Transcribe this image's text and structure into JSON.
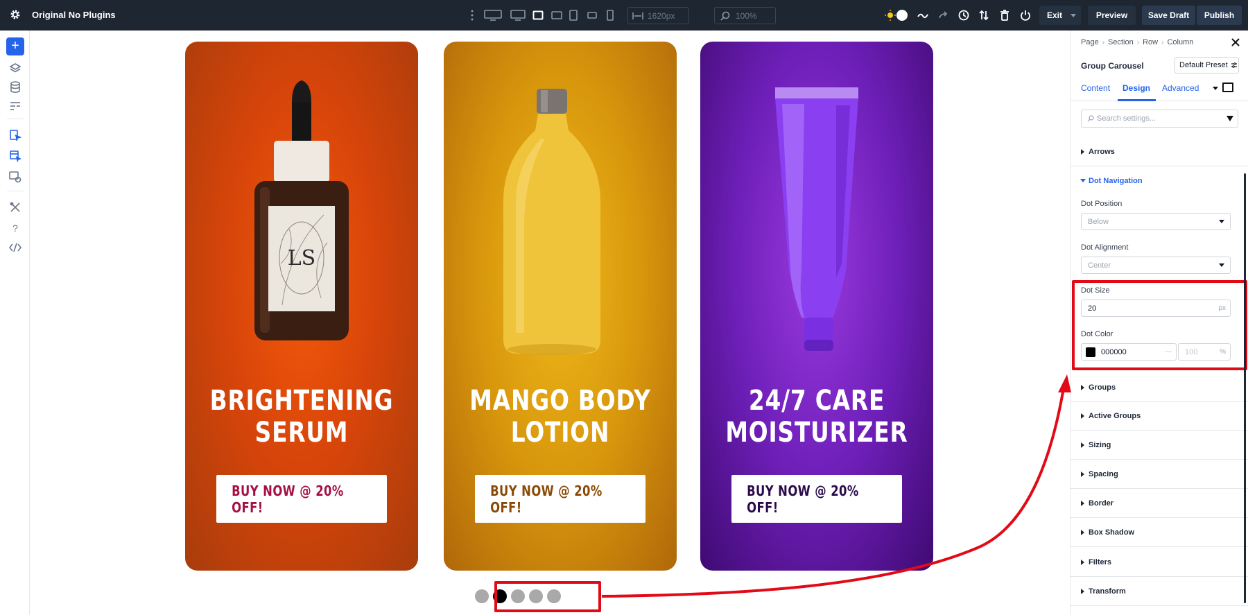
{
  "topbar": {
    "site_title": "Original No Plugins",
    "width_value": "1620px",
    "zoom_value": "100%",
    "exit_label": "Exit",
    "preview_label": "Preview",
    "save_draft_label": "Save Draft",
    "publish_label": "Publish"
  },
  "cards": [
    {
      "title_line1": "BRIGHTENING",
      "title_line2": "SERUM",
      "button_label": "BUY NOW @ 20% OFF!",
      "button_color": "#a50f45",
      "label_letters": "LS"
    },
    {
      "title_line1": "MANGO BODY",
      "title_line2": "LOTION",
      "button_label": "BUY NOW @ 20% OFF!",
      "button_color": "#8a4a06"
    },
    {
      "title_line1": "24/7 CARE",
      "title_line2": "MOISTURIZER",
      "button_label": "BUY NOW @ 20% OFF!",
      "button_color": "#2a0a4a"
    }
  ],
  "dots": {
    "count": 5,
    "active_index": 1,
    "inactive_color": "#a9a9a9",
    "active_color": "#000000"
  },
  "panel": {
    "breadcrumb": [
      "Page",
      "Section",
      "Row",
      "Column"
    ],
    "module_title": "Group Carousel",
    "preset_label": "Default Preset",
    "tabs": [
      "Content",
      "Design",
      "Advanced"
    ],
    "active_tab": "Design",
    "search_placeholder": "Search settings...",
    "arrows_label": "Arrows",
    "dot_navigation_label": "Dot Navigation",
    "dot_position_label": "Dot Position",
    "dot_position_value": "Below",
    "dot_alignment_label": "Dot Alignment",
    "dot_alignment_value": "Center",
    "dot_size_label": "Dot Size",
    "dot_size_value": "20",
    "dot_size_unit": "px",
    "dot_color_label": "Dot Color",
    "dot_color_value": "000000",
    "dot_color_swatch": "#000000",
    "dot_opacity_value": "100",
    "dot_opacity_unit": "%",
    "groups": [
      "Groups",
      "Active Groups",
      "Sizing",
      "Spacing",
      "Border",
      "Box Shadow",
      "Filters",
      "Transform"
    ]
  },
  "colors": {
    "accent": "#2563eb",
    "highlight": "#e10a17",
    "topbar_bg": "#1e2632"
  }
}
